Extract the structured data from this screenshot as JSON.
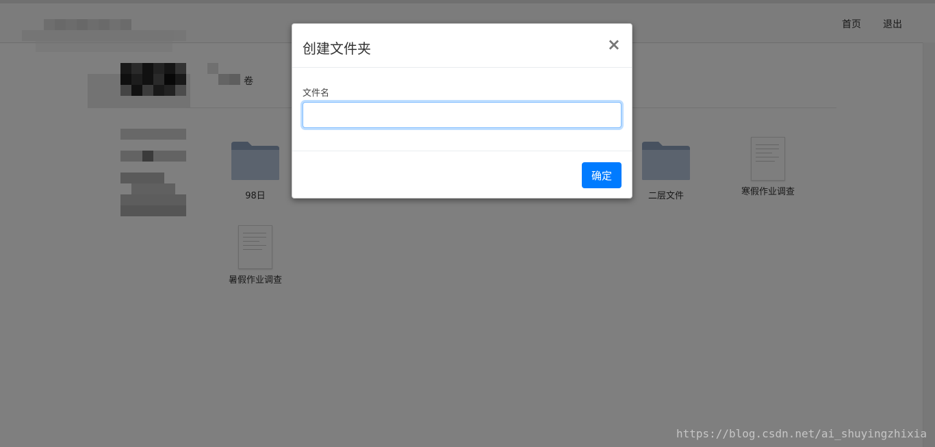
{
  "nav": {
    "home": "首页",
    "logout": "退出"
  },
  "breadcrumb": {
    "tail": "卷"
  },
  "files": [
    {
      "name": "98日",
      "kind": "folder"
    },
    {
      "name": "二层文件",
      "kind": "folder"
    },
    {
      "name": "寒假作业调查",
      "kind": "document"
    },
    {
      "name": "暑假作业调查",
      "kind": "document"
    }
  ],
  "modal": {
    "title": "创建文件夹",
    "close_glyph": "×",
    "field_label": "文件名",
    "field_value": "",
    "confirm_label": "确定"
  },
  "watermark": "https://blog.csdn.net/ai_shuyingzhixia",
  "colors": {
    "primary": "#007bff",
    "backdrop": "rgba(0,0,0,0.5)"
  }
}
